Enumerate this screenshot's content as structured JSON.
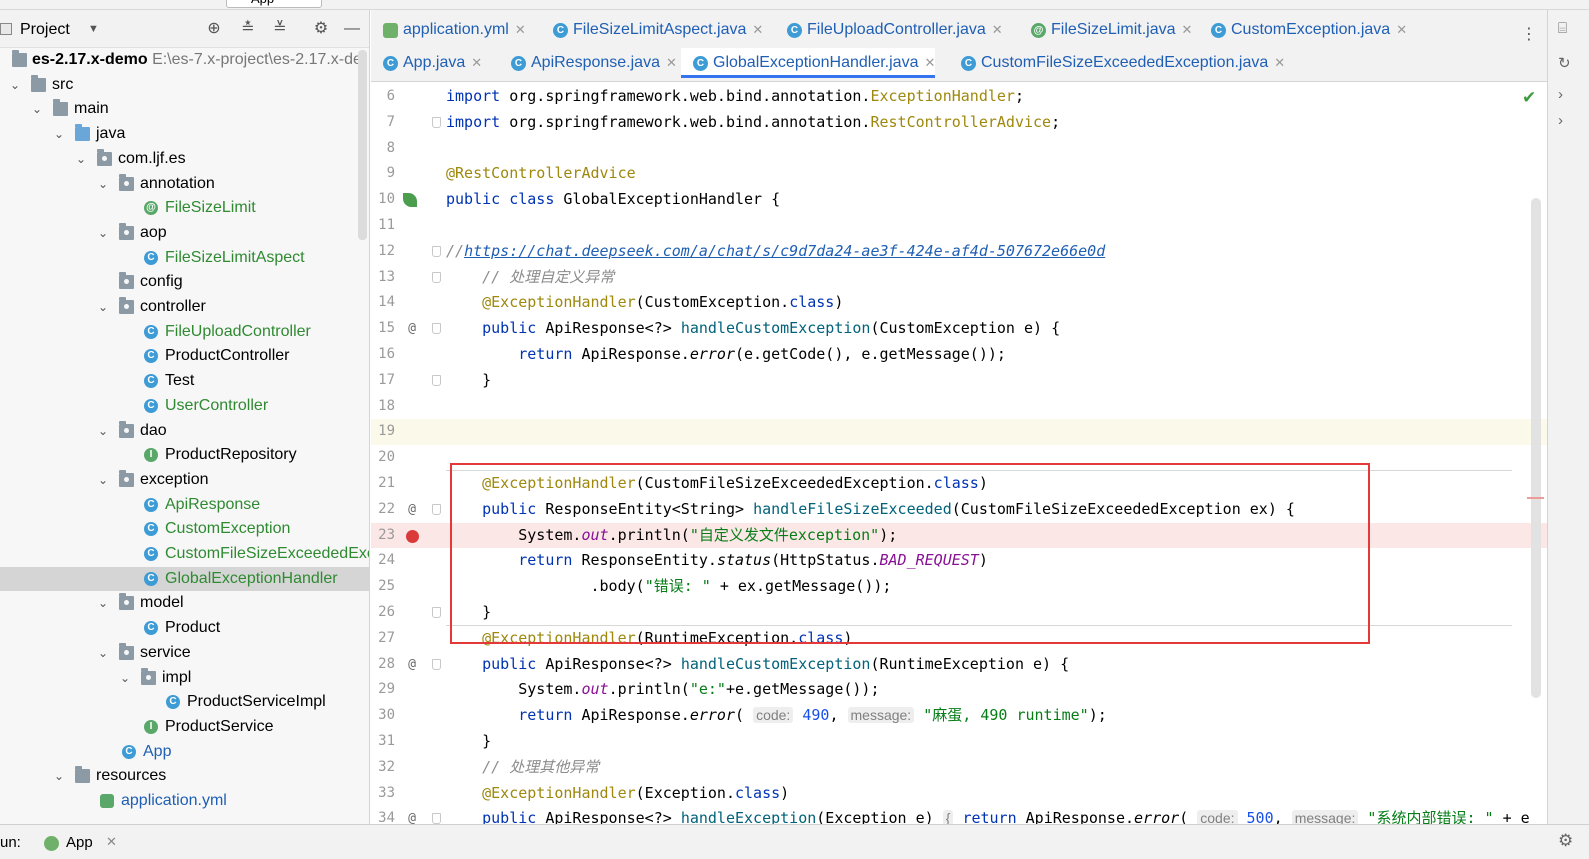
{
  "toolbar": {
    "run_config": "App"
  },
  "project_panel": {
    "title": "Project",
    "icons": [
      "target-icon",
      "expand-all-icon",
      "collapse-all-icon",
      "gear-icon",
      "hide-icon"
    ],
    "root_name": "es-2.17.x-demo",
    "root_path": "E:\\es-7.x-project\\es-2.17.x-de",
    "items": [
      {
        "label": "src",
        "depth": 0,
        "kind": "folder",
        "expanded": true
      },
      {
        "label": "main",
        "depth": 1,
        "kind": "folder",
        "expanded": true
      },
      {
        "label": "java",
        "depth": 2,
        "kind": "source-folder",
        "expanded": true
      },
      {
        "label": "com.ljf.es",
        "depth": 3,
        "kind": "package",
        "expanded": true
      },
      {
        "label": "annotation",
        "depth": 4,
        "kind": "package",
        "expanded": true
      },
      {
        "label": "FileSizeLimit",
        "depth": 5,
        "kind": "annotation"
      },
      {
        "label": "aop",
        "depth": 4,
        "kind": "package",
        "expanded": true
      },
      {
        "label": "FileSizeLimitAspect",
        "depth": 5,
        "kind": "class"
      },
      {
        "label": "config",
        "depth": 4,
        "kind": "package",
        "expanded": false
      },
      {
        "label": "controller",
        "depth": 4,
        "kind": "package",
        "expanded": true
      },
      {
        "label": "FileUploadController",
        "depth": 5,
        "kind": "class"
      },
      {
        "label": "ProductController",
        "depth": 5,
        "kind": "class"
      },
      {
        "label": "Test",
        "depth": 5,
        "kind": "class"
      },
      {
        "label": "UserController",
        "depth": 5,
        "kind": "class"
      },
      {
        "label": "dao",
        "depth": 4,
        "kind": "package",
        "expanded": true
      },
      {
        "label": "ProductRepository",
        "depth": 5,
        "kind": "interface"
      },
      {
        "label": "exception",
        "depth": 4,
        "kind": "package",
        "expanded": true
      },
      {
        "label": "ApiResponse",
        "depth": 5,
        "kind": "class"
      },
      {
        "label": "CustomException",
        "depth": 5,
        "kind": "class"
      },
      {
        "label": "CustomFileSizeExceededExc",
        "depth": 5,
        "kind": "class"
      },
      {
        "label": "GlobalExceptionHandler",
        "depth": 5,
        "kind": "class",
        "selected": true
      },
      {
        "label": "model",
        "depth": 4,
        "kind": "package",
        "expanded": true
      },
      {
        "label": "Product",
        "depth": 5,
        "kind": "class"
      },
      {
        "label": "service",
        "depth": 4,
        "kind": "package",
        "expanded": true
      },
      {
        "label": "impl",
        "depth": 5,
        "kind": "package",
        "expanded": true
      },
      {
        "label": "ProductServiceImpl",
        "depth": 6,
        "kind": "class"
      },
      {
        "label": "ProductService",
        "depth": 5,
        "kind": "interface"
      },
      {
        "label": "App",
        "depth": 4,
        "kind": "app-class"
      },
      {
        "label": "resources",
        "depth": 2,
        "kind": "resources-folder",
        "expanded": true
      },
      {
        "label": "application.yml",
        "depth": 3,
        "kind": "yml"
      }
    ]
  },
  "tabs_row1": [
    {
      "label": "application.yml",
      "icon": "yml-icon"
    },
    {
      "label": "FileSizeLimitAspect.java",
      "icon": "class-icon"
    },
    {
      "label": "FileUploadController.java",
      "icon": "class-icon"
    },
    {
      "label": "FileSizeLimit.java",
      "icon": "annotation-icon"
    },
    {
      "label": "CustomException.java",
      "icon": "class-icon"
    }
  ],
  "tabs_row2": [
    {
      "label": "App.java",
      "icon": "app-icon"
    },
    {
      "label": "ApiResponse.java",
      "icon": "class-icon"
    },
    {
      "label": "GlobalExceptionHandler.java",
      "icon": "class-icon",
      "active": true
    },
    {
      "label": "CustomFileSizeExceededException.java",
      "icon": "class-icon"
    }
  ],
  "editor": {
    "line_numbers": [
      "6",
      "7",
      "8",
      "9",
      "10",
      "11",
      "12",
      "13",
      "14",
      "15",
      "16",
      "17",
      "18",
      "19",
      "20",
      "21",
      "22",
      "23",
      "24",
      "25",
      "26",
      "27",
      "28",
      "29",
      "30",
      "31",
      "32",
      "33",
      "34"
    ],
    "code": {
      "l6": [
        "import",
        " org.springframework.web.bind.annotation.",
        "ExceptionHandler",
        ";"
      ],
      "l7": [
        "import",
        " org.springframework.web.bind.annotation.",
        "RestControllerAdvice",
        ";"
      ],
      "l9": "@RestControllerAdvice",
      "l10": [
        "public",
        " ",
        "class",
        " GlobalExceptionHandler {"
      ],
      "l12a": "//",
      "l12b": "https://chat.deepseek.com/a/chat/s/c9d7da24-ae3f-424e-af4d-507672e66e0d",
      "l13": "    // 处理自定义异常",
      "l14": [
        "    ",
        "@ExceptionHandler",
        "(CustomException.",
        "class",
        ")"
      ],
      "l15": [
        "    ",
        "public",
        " ApiResponse<?> ",
        "handleCustomException",
        "(CustomException e) {"
      ],
      "l16": [
        "        ",
        "return",
        " ApiResponse.",
        "error",
        "(e.getCode(), e.getMessage());"
      ],
      "l17": "    }",
      "l21": [
        "    ",
        "@ExceptionHandler",
        "(CustomFileSizeExceededException.",
        "class",
        ")"
      ],
      "l22": [
        "    ",
        "public",
        " ResponseEntity<String> ",
        "handleFileSizeExceeded",
        "(CustomFileSizeExceededException ex) {"
      ],
      "l23": [
        "        System.",
        "out",
        ".println(",
        "\"自定义发文件exception\"",
        ");"
      ],
      "l24": [
        "        ",
        "return",
        " ResponseEntity.",
        "status",
        "(HttpStatus.",
        "BAD_REQUEST",
        ")"
      ],
      "l25": [
        "                .body(",
        "\"错误: \"",
        " + ex.getMessage());"
      ],
      "l26": "    }",
      "l27": [
        "    ",
        "@ExceptionHandler",
        "(RuntimeException.",
        "class",
        ")"
      ],
      "l28": [
        "    ",
        "public",
        " ApiResponse<?> ",
        "handleCustomException",
        "(RuntimeException e) {"
      ],
      "l29": [
        "        System.",
        "out",
        ".println(",
        "\"e:\"",
        "+e.getMessage());"
      ],
      "l30": [
        "        ",
        "return",
        " ApiResponse.",
        "error",
        "( ",
        "code:",
        " ",
        "490",
        ", ",
        "message:",
        " ",
        "\"麻蛋, 490 runtime\"",
        ");"
      ],
      "l31": "    }",
      "l32": "    // 处理其他异常",
      "l33": [
        "    ",
        "@ExceptionHandler",
        "(Exception.",
        "class",
        ")"
      ],
      "l34": [
        "    ",
        "public",
        " ApiResponse<?> ",
        "handleException",
        "(Exception e) ",
        "{",
        " ",
        "return",
        " ApiResponse.",
        "error",
        "( ",
        "code:",
        " ",
        "500",
        ", ",
        "message:",
        " ",
        "\"系统内部错误: \"",
        " + e"
      ]
    }
  },
  "run_bar": {
    "label": "un:",
    "config": "App"
  }
}
